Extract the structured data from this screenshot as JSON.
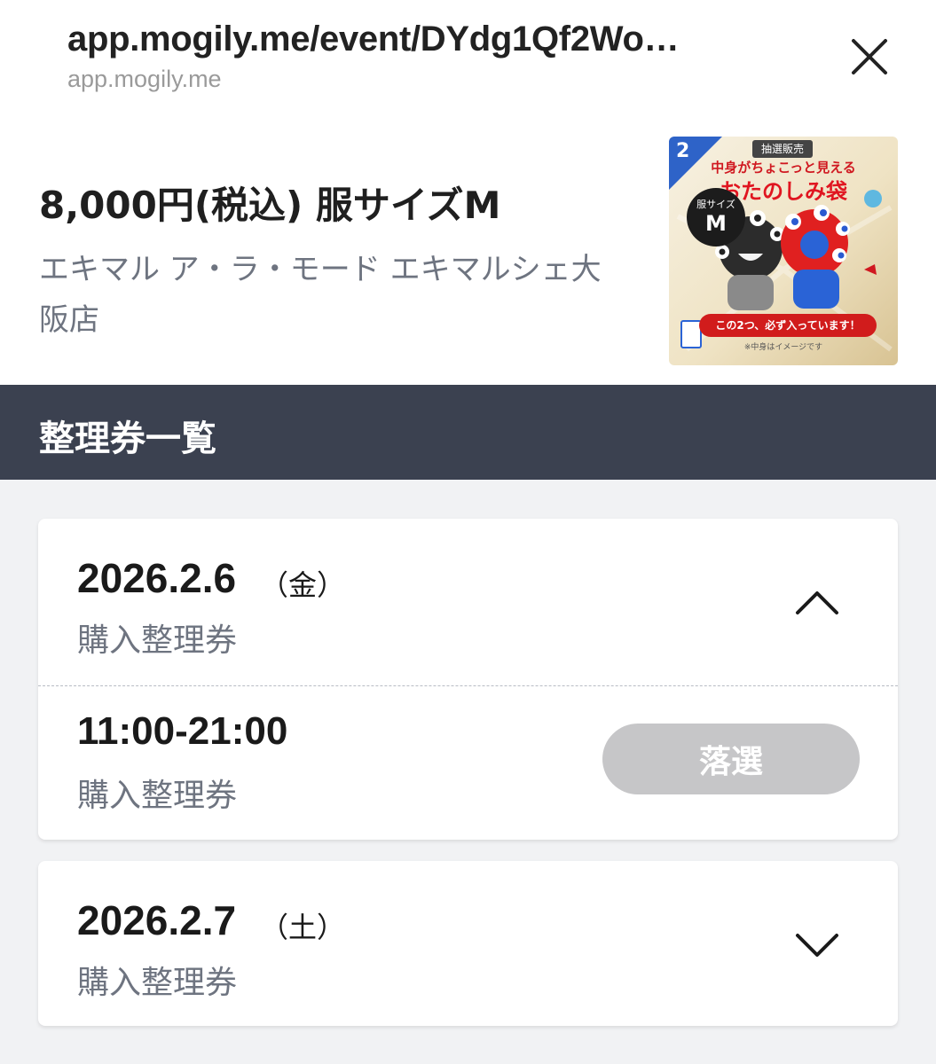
{
  "browser": {
    "url_title": "app.mogily.me/event/DYdg1Qf2Wo…",
    "url_host": "app.mogily.me"
  },
  "product": {
    "title": "8,000円(税込) 服サイズM",
    "store": "エキマル ア・ラ・モード エキマルシェ大阪店",
    "thumbnail": {
      "number": "2",
      "badge": "抽選販売",
      "line1": "中身がちょこっと見える",
      "line2": "おたのしみ袋",
      "size_label": "服サイズ",
      "size_value": "M",
      "footer": "この2つ、必ず入っています！",
      "note": "※中身はイメージです"
    }
  },
  "section": {
    "title": "整理券一覧"
  },
  "days": [
    {
      "date": "2026.2.6",
      "weekday": "（金）",
      "label": "購入整理券",
      "expanded": true,
      "slots": [
        {
          "time": "11:00-21:00",
          "label": "購入整理券",
          "status": "落選"
        }
      ]
    },
    {
      "date": "2026.2.7",
      "weekday": "（土）",
      "label": "購入整理券",
      "expanded": false
    }
  ],
  "icons": {
    "close": "close-icon",
    "collapse": "chevron-up-icon",
    "expand": "chevron-down-icon"
  },
  "colors": {
    "section_header_bg": "#3b4150",
    "list_bg": "#f1f2f4",
    "muted_text": "#6e7480",
    "disabled_button": "#c6c6c8"
  }
}
